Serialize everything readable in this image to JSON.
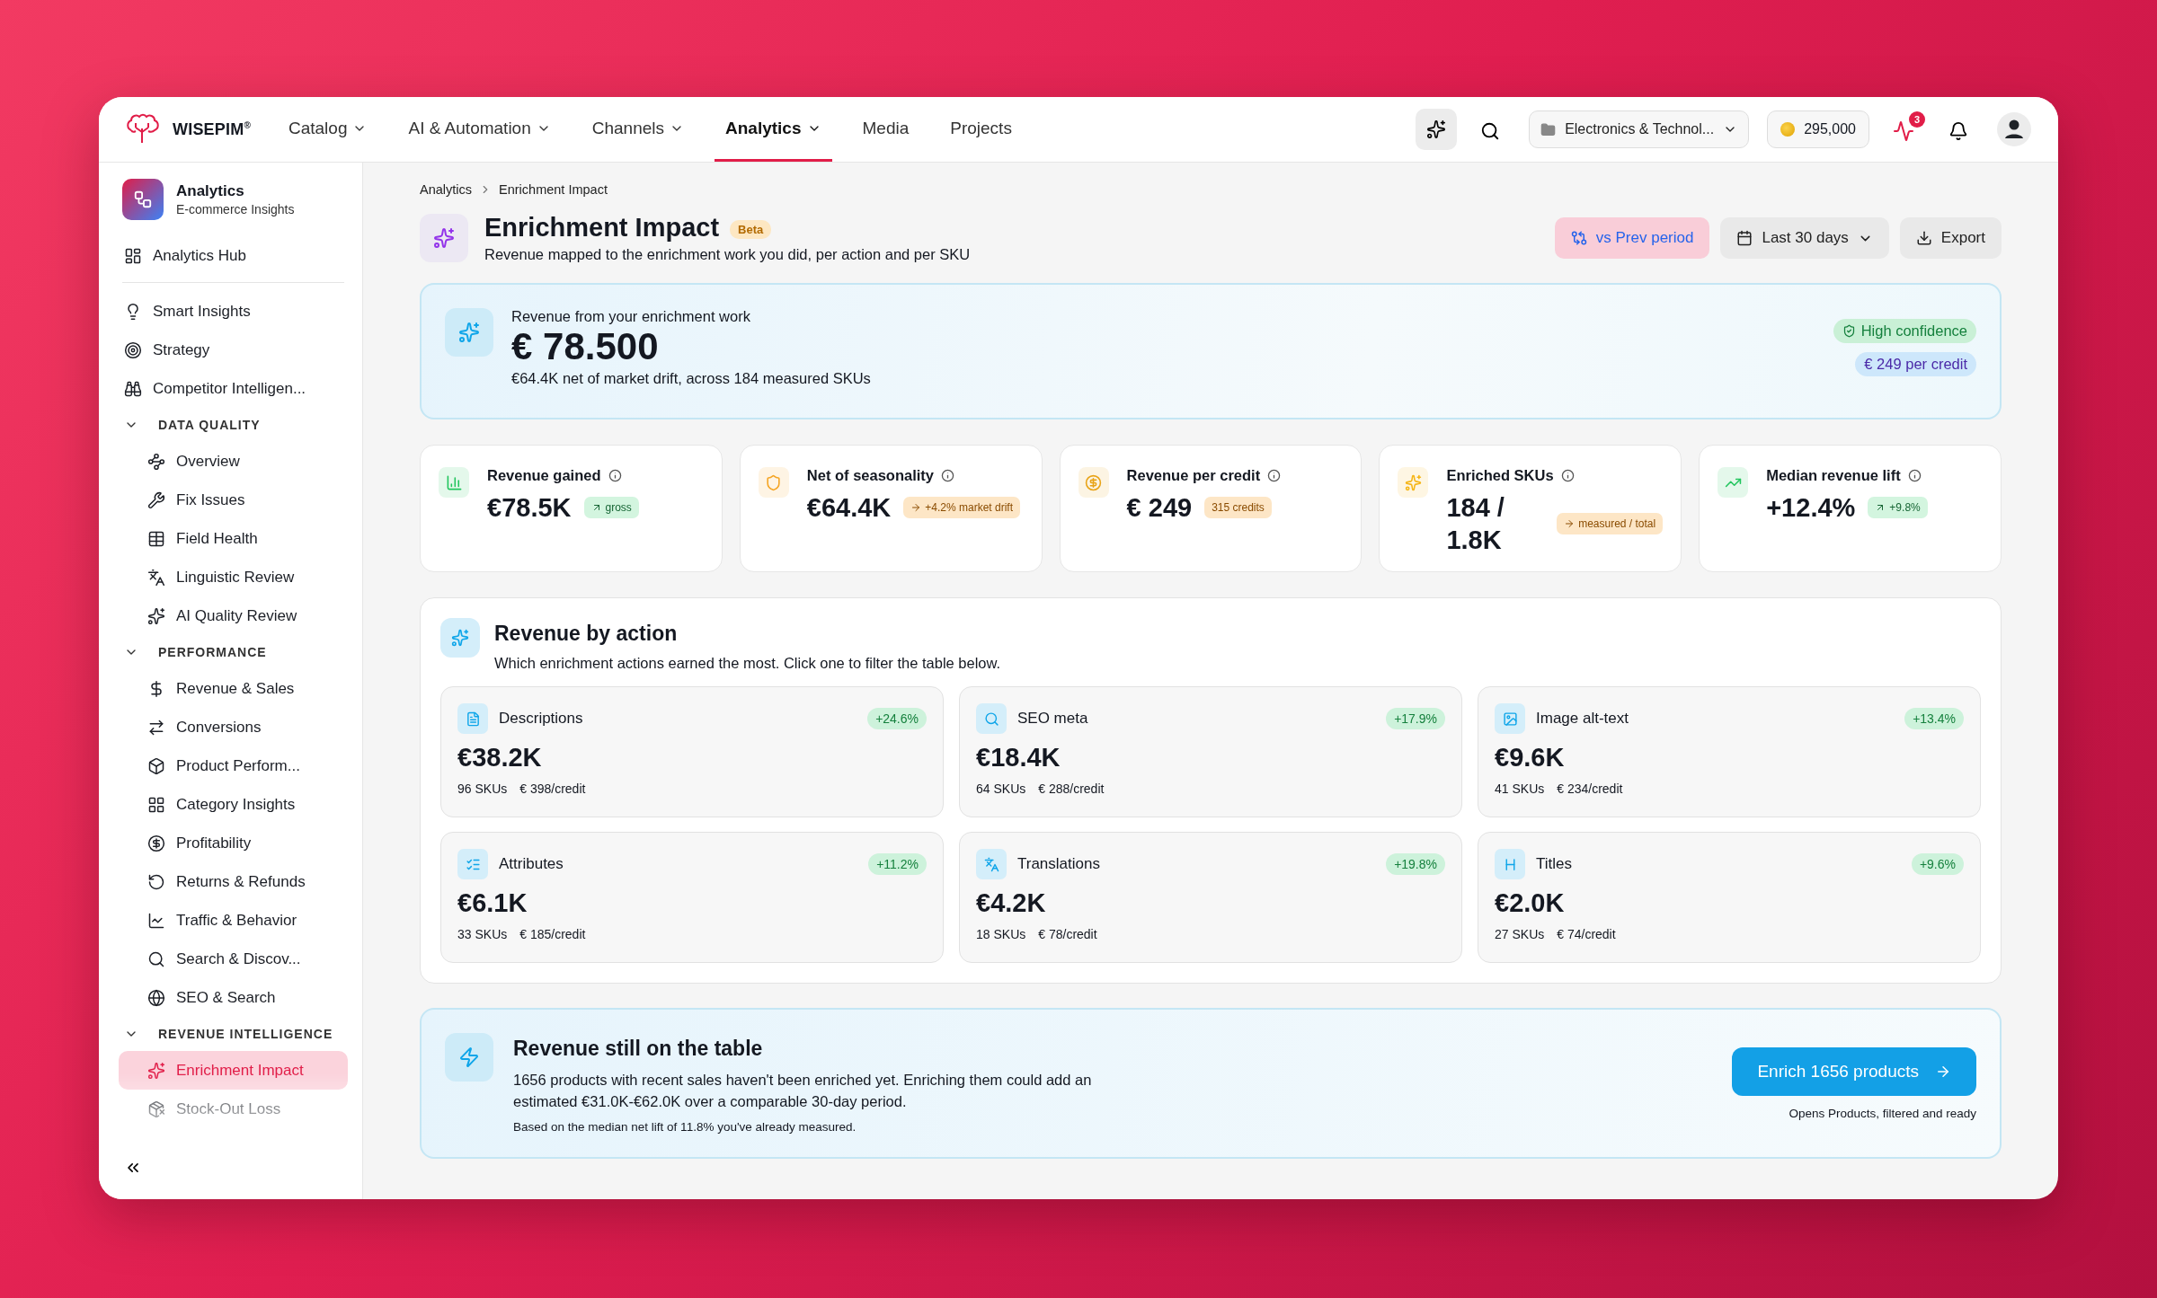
{
  "topbar": {
    "brand": "WISEPIM$^{®}$",
    "nav": [
      {
        "label": "Catalog",
        "has_menu": true,
        "selected": false
      },
      {
        "label": "AI & Automation",
        "has_menu": true,
        "selected": false
      },
      {
        "label": "Channels",
        "has_menu": true,
        "selected": false
      },
      {
        "label": "Analytics",
        "has_menu": true,
        "selected": true
      },
      {
        "label": "Media",
        "has_menu": false,
        "selected": false
      },
      {
        "label": "Projects",
        "has_menu": false,
        "selected": false
      }
    ],
    "workspace": "Electronics & Technol...",
    "credits": "295,000",
    "alerts_badge": "3"
  },
  "sidebar": {
    "title": "Analytics",
    "subtitle": "E-commerce Insights",
    "items": [
      {
        "kind": "link",
        "label": "Analytics Hub",
        "selected": false
      },
      {
        "kind": "divider"
      },
      {
        "kind": "link",
        "label": "Smart Insights",
        "selected": false
      },
      {
        "kind": "link",
        "label": "Strategy",
        "selected": false
      },
      {
        "kind": "link",
        "label": "Competitor Intelligen...",
        "selected": false
      },
      {
        "kind": "section",
        "label": "DATA QUALITY",
        "expanded": true,
        "children": [
          {
            "label": "Overview",
            "selected": false
          },
          {
            "label": "Fix Issues",
            "selected": false
          },
          {
            "label": "Field Health",
            "selected": false
          },
          {
            "label": "Linguistic Review",
            "selected": false
          },
          {
            "label": "AI Quality Review",
            "selected": false
          }
        ]
      },
      {
        "kind": "section",
        "label": "PERFORMANCE",
        "expanded": true,
        "children": [
          {
            "label": "Revenue & Sales",
            "selected": false
          },
          {
            "label": "Conversions",
            "selected": false
          },
          {
            "label": "Product Perform...",
            "selected": false
          },
          {
            "label": "Category Insights",
            "selected": false
          },
          {
            "label": "Profitability",
            "selected": false
          },
          {
            "label": "Returns & Refunds",
            "selected": false
          },
          {
            "label": "Traffic & Behavior",
            "selected": false
          },
          {
            "label": "Search & Discov...",
            "selected": false
          },
          {
            "label": "SEO & Search",
            "selected": false
          }
        ]
      },
      {
        "kind": "section",
        "label": "REVENUE INTELLIGENCE",
        "expanded": true,
        "children": [
          {
            "label": "Enrichment Impact",
            "selected": true
          },
          {
            "label": "Stock-Out Loss",
            "selected": false
          }
        ]
      }
    ]
  },
  "header": {
    "breadcrumb": [
      "Analytics",
      "Enrichment Impact"
    ],
    "title": "Enrichment Impact",
    "badge": "Beta",
    "subtitle": "Revenue mapped to the enrichment work you did, per action and per SKU",
    "actions": [
      {
        "kind": "toggle",
        "label": "vs Prev period",
        "selected": true
      },
      {
        "kind": "dropdown",
        "label": "Last 30 days"
      },
      {
        "kind": "button",
        "label": "Export"
      }
    ]
  },
  "hero": {
    "label": "Revenue from your enrichment work",
    "value": "€ 78.500",
    "note": "€64.4K net of market drift, across 184 measured SKUs",
    "badges": [
      {
        "kind": "confidence",
        "label": "High confidence"
      },
      {
        "kind": "rate",
        "label": "€ 249 per credit"
      }
    ]
  },
  "kpis": [
    {
      "label": "Revenue gained",
      "value": "€78.5K",
      "badge": {
        "kind": "up",
        "label": "gross"
      },
      "color": "#22c55e"
    },
    {
      "label": "Net of seasonality",
      "value": "€64.4K",
      "badge": {
        "kind": "flat",
        "label": "+4.2% market drift"
      },
      "color": "#f5a524"
    },
    {
      "label": "Revenue per credit",
      "value": "€ 249",
      "badge": {
        "kind": "plain",
        "label": "315 credits"
      },
      "color": "#e8a317"
    },
    {
      "label": "Enriched SKUs",
      "value": "184 / 1.8K",
      "badge": {
        "kind": "flat",
        "label": "measured / total"
      },
      "color": "#f5b516"
    },
    {
      "label": "Median revenue lift",
      "value": "+12.4%",
      "badge": {
        "kind": "up",
        "label": "+9.8%"
      },
      "color": "#22c55e"
    }
  ],
  "by_action": {
    "title": "Revenue by action",
    "subtitle": "Which enrichment actions earned the most. Click one to filter the table below.",
    "actions": [
      {
        "label": "Descriptions",
        "delta": "+24.6%",
        "value": "€38.2K",
        "skus": "96 SKUs",
        "per_credit": "€ 398/credit"
      },
      {
        "label": "SEO meta",
        "delta": "+17.9%",
        "value": "€18.4K",
        "skus": "64 SKUs",
        "per_credit": "€ 288/credit"
      },
      {
        "label": "Image alt-text",
        "delta": "+13.4%",
        "value": "€9.6K",
        "skus": "41 SKUs",
        "per_credit": "€ 234/credit"
      },
      {
        "label": "Attributes",
        "delta": "+11.2%",
        "value": "€6.1K",
        "skus": "33 SKUs",
        "per_credit": "€ 185/credit"
      },
      {
        "label": "Translations",
        "delta": "+19.8%",
        "value": "€4.2K",
        "skus": "18 SKUs",
        "per_credit": "€ 78/credit"
      },
      {
        "label": "Titles",
        "delta": "+9.6%",
        "value": "€2.0K",
        "skus": "27 SKUs",
        "per_credit": "€ 74/credit"
      }
    ]
  },
  "opportunity": {
    "title": "Revenue still on the table",
    "text": "1656 products with recent sales haven't been enriched yet. Enriching them could add an estimated €31.0K-€62.0K over a comparable 30-day period.",
    "note": "Based on the median net lift of 11.8% you've already measured.",
    "button": "Enrich 1656 products",
    "caption": "Opens Products, filtered and ready"
  }
}
